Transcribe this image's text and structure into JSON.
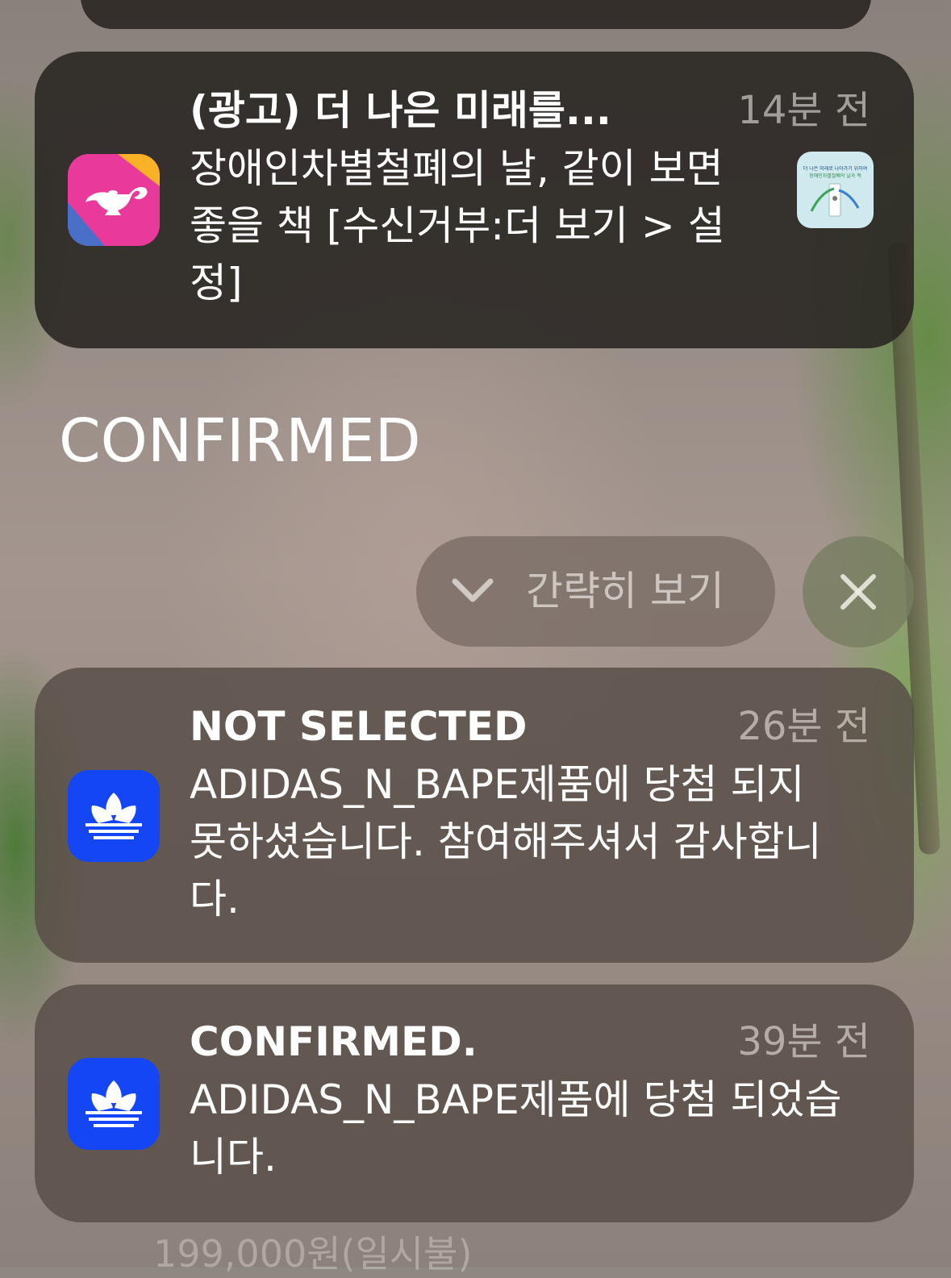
{
  "notifications_above": [
    {
      "app_icon": "genie-lamp-icon",
      "title": "(광고) 더 나은 미래를...",
      "time": "14분 전",
      "body": "장애인차별철폐의 날, 같이 보면 좋을 책 [수신거부:더 보기 > 설정]",
      "thumbnail": {
        "line1": "더 나은 미래로 나아가기 위하여",
        "line2": "장애인차별철폐의 날과 책"
      }
    }
  ],
  "group": {
    "title": "CONFIRMED",
    "collapse_label": "간략히 보기",
    "close_icon": "close-icon"
  },
  "notifications": [
    {
      "app_icon": "adidas-originals-icon",
      "title": "NOT SELECTED",
      "time": "26분 전",
      "body": "ADIDAS_N_BAPE제품에 당첨 되지 못하셨습니다. 참여해주셔서 감사합니다."
    },
    {
      "app_icon": "adidas-originals-icon",
      "title": "CONFIRMED.",
      "time": "39분 전",
      "body": "ADIDAS_N_BAPE제품에 당첨 되었습니다."
    }
  ],
  "background_peek": {
    "price_text": "199,000원(일시불)"
  },
  "colors": {
    "adidas_blue": "#1546F5",
    "genie_pink": "#E9399A",
    "genie_yellow": "#F9B126",
    "genie_blue": "#4A6FC9"
  }
}
